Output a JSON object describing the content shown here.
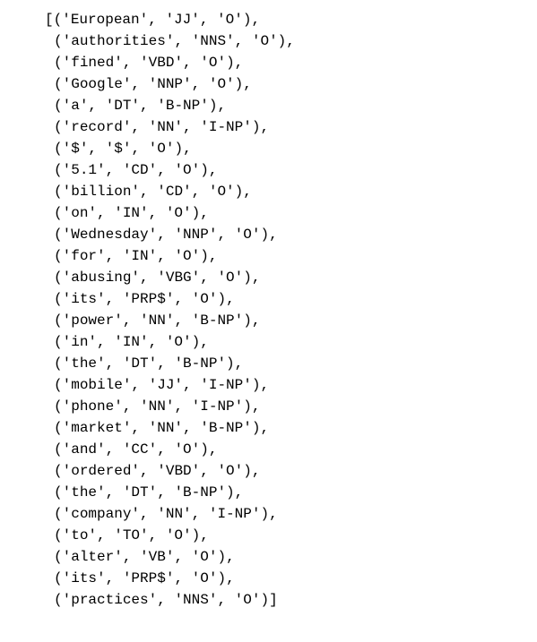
{
  "open_bracket": "[",
  "close_bracket": "]",
  "open_paren": "(",
  "close_paren": ")",
  "elem_sep": ", ",
  "tuple_sep": ",",
  "tokens": [
    {
      "word": "'European'",
      "pos": "'JJ'",
      "iob": "'O'"
    },
    {
      "word": "'authorities'",
      "pos": "'NNS'",
      "iob": "'O'"
    },
    {
      "word": "'fined'",
      "pos": "'VBD'",
      "iob": "'O'"
    },
    {
      "word": "'Google'",
      "pos": "'NNP'",
      "iob": "'O'"
    },
    {
      "word": "'a'",
      "pos": "'DT'",
      "iob": "'B-NP'"
    },
    {
      "word": "'record'",
      "pos": "'NN'",
      "iob": "'I-NP'"
    },
    {
      "word": "'$'",
      "pos": "'$'",
      "iob": "'O'"
    },
    {
      "word": "'5.1'",
      "pos": "'CD'",
      "iob": "'O'"
    },
    {
      "word": "'billion'",
      "pos": "'CD'",
      "iob": "'O'"
    },
    {
      "word": "'on'",
      "pos": "'IN'",
      "iob": "'O'"
    },
    {
      "word": "'Wednesday'",
      "pos": "'NNP'",
      "iob": "'O'"
    },
    {
      "word": "'for'",
      "pos": "'IN'",
      "iob": "'O'"
    },
    {
      "word": "'abusing'",
      "pos": "'VBG'",
      "iob": "'O'"
    },
    {
      "word": "'its'",
      "pos": "'PRP$'",
      "iob": "'O'"
    },
    {
      "word": "'power'",
      "pos": "'NN'",
      "iob": "'B-NP'"
    },
    {
      "word": "'in'",
      "pos": "'IN'",
      "iob": "'O'"
    },
    {
      "word": "'the'",
      "pos": "'DT'",
      "iob": "'B-NP'"
    },
    {
      "word": "'mobile'",
      "pos": "'JJ'",
      "iob": "'I-NP'"
    },
    {
      "word": "'phone'",
      "pos": "'NN'",
      "iob": "'I-NP'"
    },
    {
      "word": "'market'",
      "pos": "'NN'",
      "iob": "'B-NP'"
    },
    {
      "word": "'and'",
      "pos": "'CC'",
      "iob": "'O'"
    },
    {
      "word": "'ordered'",
      "pos": "'VBD'",
      "iob": "'O'"
    },
    {
      "word": "'the'",
      "pos": "'DT'",
      "iob": "'B-NP'"
    },
    {
      "word": "'company'",
      "pos": "'NN'",
      "iob": "'I-NP'"
    },
    {
      "word": "'to'",
      "pos": "'TO'",
      "iob": "'O'"
    },
    {
      "word": "'alter'",
      "pos": "'VB'",
      "iob": "'O'"
    },
    {
      "word": "'its'",
      "pos": "'PRP$'",
      "iob": "'O'"
    },
    {
      "word": "'practices'",
      "pos": "'NNS'",
      "iob": "'O'"
    }
  ]
}
